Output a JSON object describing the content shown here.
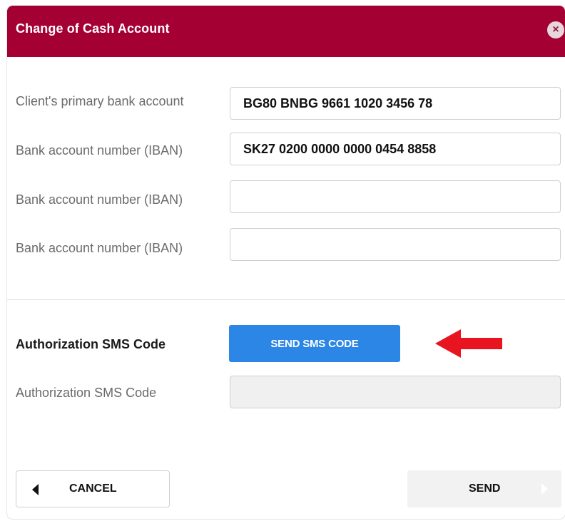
{
  "dialog": {
    "title": "Change of Cash Account",
    "close_icon": "close-icon"
  },
  "form": {
    "rows": [
      {
        "label": "Client's primary bank account",
        "value": "BG80 BNBG 9661 1020 3456 78",
        "placeholder": ""
      },
      {
        "label": "Bank account number (IBAN)",
        "value": "SK27 0200 0000 0000 0454 8858",
        "placeholder": ""
      },
      {
        "label": "Bank account number (IBAN)",
        "value": "",
        "placeholder": ""
      },
      {
        "label": "Bank account number (IBAN)",
        "value": "",
        "placeholder": ""
      }
    ]
  },
  "sms": {
    "heading": "Authorization SMS Code",
    "send_button": "SEND SMS CODE",
    "code_label": "Authorization SMS Code",
    "code_value": ""
  },
  "footer": {
    "cancel_label": "CANCEL",
    "send_label": "SEND"
  },
  "colors": {
    "header": "#a50034",
    "primary_button": "#2b86e5",
    "annotation_arrow": "#e8141f"
  }
}
